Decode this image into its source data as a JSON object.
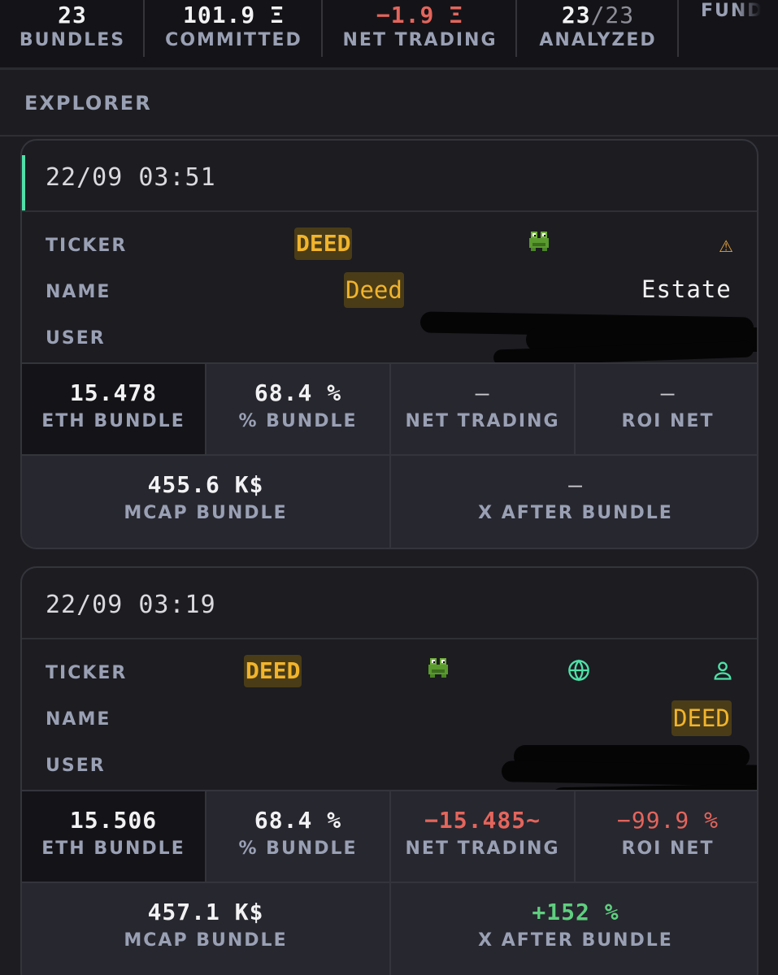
{
  "stats": [
    {
      "value": "23",
      "label": "BUNDLES"
    },
    {
      "value": "101.9 Ξ",
      "label": "COMMITTED"
    },
    {
      "value": "−1.9 Ξ",
      "label": "NET TRADING"
    },
    {
      "value": "23",
      "value_total": "/23",
      "label": "ANALYZED"
    },
    {
      "value": "",
      "label": "FUND"
    }
  ],
  "explorer": {
    "title": "EXPLORER"
  },
  "labels": {
    "ticker": "TICKER",
    "name": "NAME",
    "user": "USER",
    "eth_bundle": "ETH BUNDLE",
    "pct_bundle": "% BUNDLE",
    "net_trading": "NET TRADING",
    "roi_net": "ROI NET",
    "mcap_bundle": "MCAP BUNDLE",
    "x_after_bundle": "X AFTER BUNDLE"
  },
  "cards": [
    {
      "date": "22/09 03:51",
      "ticker": "DEED",
      "name_part1": "Deed",
      "name_part2": "Estate",
      "icons": [
        "frog-icon",
        "warning-icon"
      ],
      "eth_bundle": "15.478",
      "pct_bundle": "68.4 %",
      "net_trading": "—",
      "roi_net": "—",
      "mcap_bundle": "455.6 K$",
      "x_after_bundle": "—"
    },
    {
      "date": "22/09 03:19",
      "ticker": "DEED",
      "name": "DEED",
      "icons": [
        "frog-icon",
        "globe-icon",
        "user-icon"
      ],
      "eth_bundle": "15.506",
      "pct_bundle": "68.4 %",
      "net_trading": "−15.485~",
      "roi_net": "−99.9 %",
      "mcap_bundle": "457.1 K$",
      "x_after_bundle": "+152 %"
    }
  ],
  "colors": {
    "negative": "#e4655c",
    "positive": "#5fcf7f",
    "accent": "#4fe0a8",
    "ticker": "#f1b42c"
  }
}
